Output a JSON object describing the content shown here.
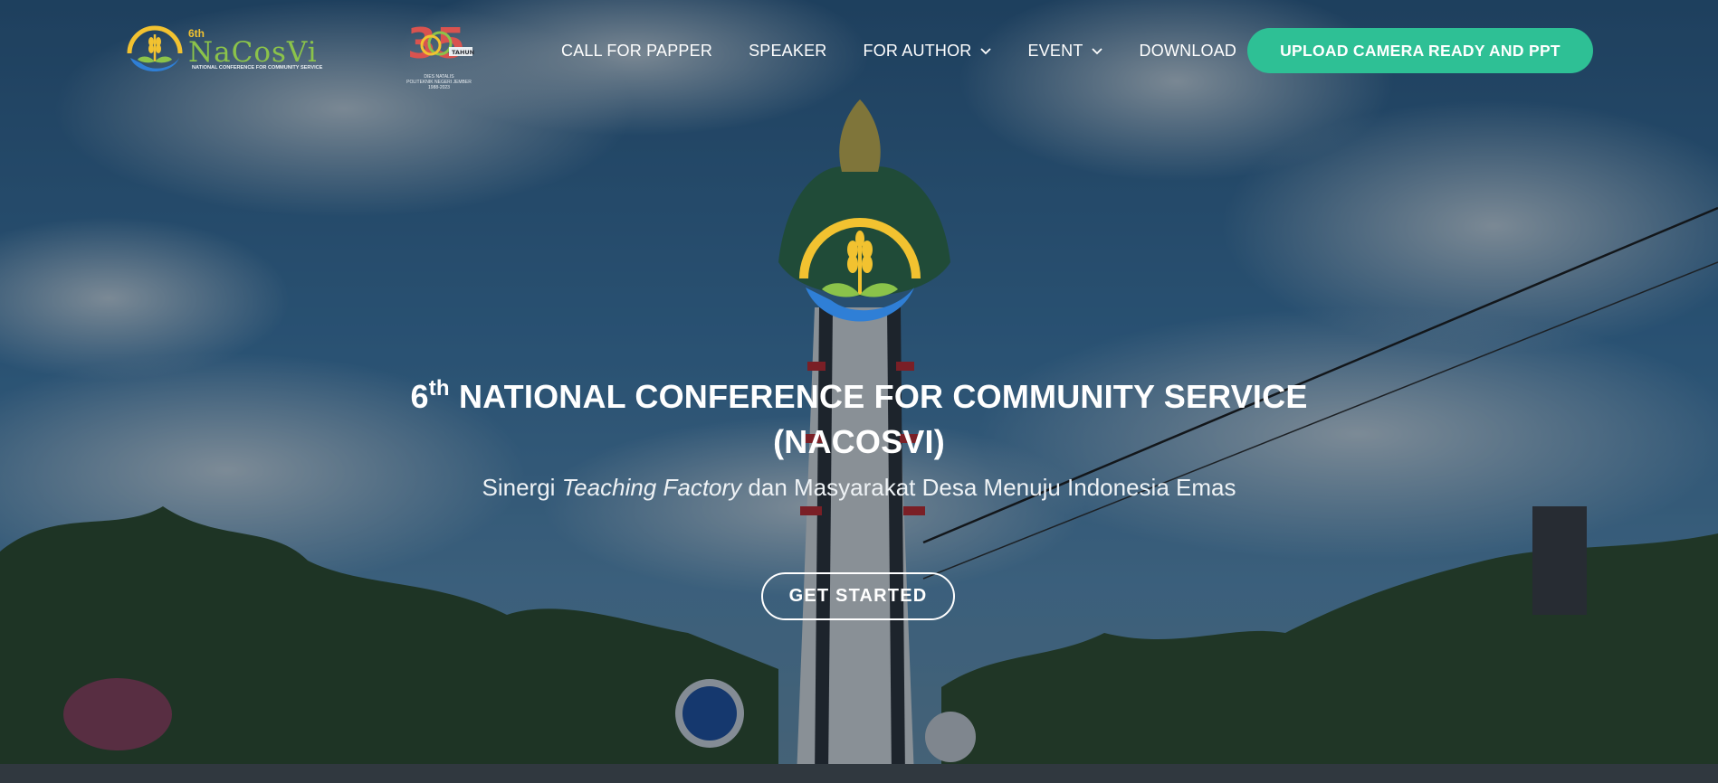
{
  "brand": {
    "edition": "6th",
    "name": "NaCosVi",
    "subtitle": "NATIONAL CONFERENCE FOR COMMUNITY SERVICE"
  },
  "anniversary": {
    "number": "35",
    "badge": "TAHUN",
    "caption_line1": "DIES NATALIS",
    "caption_line2": "POLITEKNIK NEGERI JEMBER",
    "caption_line3": "1988-2023"
  },
  "nav": {
    "items": [
      {
        "label": "CALL FOR PAPPER",
        "dropdown": false
      },
      {
        "label": "SPEAKER",
        "dropdown": false
      },
      {
        "label": "FOR AUTHOR",
        "dropdown": true
      },
      {
        "label": "EVENT",
        "dropdown": true
      },
      {
        "label": "DOWNLOAD",
        "dropdown": false
      }
    ],
    "cta_label": "UPLOAD CAMERA READY AND PPT"
  },
  "hero": {
    "title_number": "6",
    "title_suffix": "th",
    "title_line1_rest": "NATIONAL CONFERENCE FOR COMMUNITY SERVICE",
    "title_line2": "(NACOSVI)",
    "tagline_pre": "Sinergi",
    "tagline_em": "Teaching Factory",
    "tagline_post": "dan Masyarakat Desa Menuju Indonesia Emas",
    "button_label": "GET STARTED"
  },
  "colors": {
    "accent": "#2ec095",
    "logo_gold": "#f2c230",
    "logo_green": "#8bc34a",
    "logo_blue": "#2f7fd6"
  },
  "icons": {
    "dropdown": "chevron-down-icon",
    "brand": "rice-leaf-logo-icon"
  }
}
